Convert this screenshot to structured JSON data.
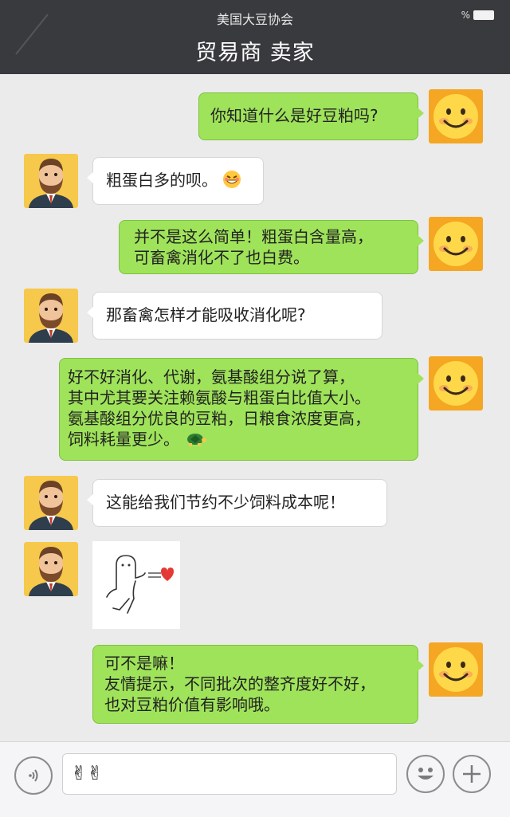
{
  "status_bar": {
    "title": "美国大豆协会",
    "battery_text": "%"
  },
  "header": {
    "title": "贸易商  卖家"
  },
  "messages": [
    {
      "side": "right",
      "lines": [
        "你知道什么是好豆粕吗?"
      ]
    },
    {
      "side": "left",
      "lines": [
        "粗蛋白多的呗。"
      ],
      "emoji": "grin-emoji"
    },
    {
      "side": "right",
      "lines": [
        "并不是这么简单！粗蛋白含量高，",
        "可畜禽消化不了也白费。"
      ]
    },
    {
      "side": "left",
      "lines": [
        "那畜禽怎样才能吸收消化呢?"
      ]
    },
    {
      "side": "right",
      "lines": [
        "好不好消化、代谢，氨基酸组分说了算，",
        "其中尤其要关注赖氨酸与粗蛋白比值大小。",
        "氨基酸组分优良的豆粕，日粮食浓度更高，",
        "饲料耗量更少。"
      ],
      "emoji": "turtle-emoji"
    },
    {
      "side": "left",
      "lines": [
        "这能给我们节约不少饲料成本呢！"
      ]
    },
    {
      "side": "left",
      "type": "sticker",
      "sticker": "cartoon-heart-sticker"
    },
    {
      "side": "right",
      "lines": [
        "可不是嘛！",
        "友情提示，不同批次的整齐度好不好，",
        "也对豆粕价值有影响哦。"
      ]
    }
  ],
  "input_bar": {
    "value": "✌✌"
  },
  "colors": {
    "header_bg": "#393a3e",
    "chat_bg": "#ebebeb",
    "right_bubble": "#9fe35a",
    "left_bubble": "#ffffff"
  }
}
